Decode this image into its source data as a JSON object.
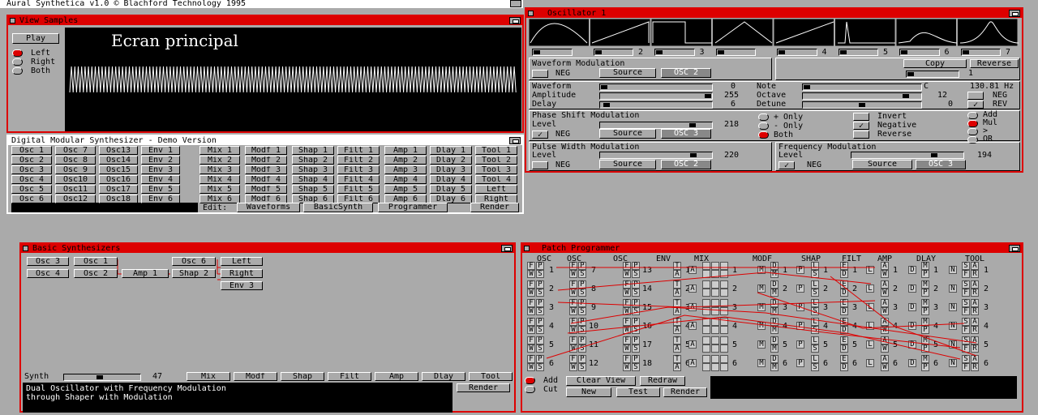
{
  "screen_title": "Aural Synthetica v1.0  © Blachford Technology 1995",
  "view_samples": {
    "title": "View Samples",
    "play": "Play",
    "overlay": "Ecran principal",
    "channels": [
      "Left",
      "Right",
      "Both"
    ],
    "selected": "Left"
  },
  "dms": {
    "title": "Digital Modular Synthesizer - Demo Version",
    "columns": [
      [
        "Osc 1",
        "Osc 2",
        "Osc 3",
        "Osc 4",
        "Osc 5",
        "Osc 6"
      ],
      [
        "Osc 7",
        "Osc 8",
        "Osc 9",
        "Osc10",
        "Osc11",
        "Osc12"
      ],
      [
        "Osc13",
        "Osc14",
        "Osc15",
        "Osc16",
        "Osc17",
        "Osc18"
      ],
      [
        "Env 1",
        "Env 2",
        "Env 3",
        "Env 4",
        "Env 5",
        "Env 6"
      ],
      [
        "Mix 1",
        "Mix 2",
        "Mix 3",
        "Mix 4",
        "Mix 5",
        "Mix 6"
      ],
      [
        "Modf 1",
        "Modf 2",
        "Modf 3",
        "Modf 4",
        "Modf 5",
        "Modf 6"
      ],
      [
        "Shap 1",
        "Shap 2",
        "Shap 3",
        "Shap 4",
        "Shap 5",
        "Shap 6"
      ],
      [
        "Filt 1",
        "Filt 2",
        "Filt 3",
        "Filt 4",
        "Filt 5",
        "Filt 6"
      ],
      [
        "Amp 1",
        "Amp 2",
        "Amp 3",
        "Amp 4",
        "Amp 5",
        "Amp 6"
      ],
      [
        "Dlay 1",
        "Dlay 2",
        "Dlay 3",
        "Dlay 4",
        "Dlay 5",
        "Dlay 6"
      ],
      [
        "Tool 1",
        "Tool 2",
        "Tool 3",
        "Tool 4",
        "Left",
        "Right"
      ]
    ],
    "edit_label": "Edit:",
    "edit_buttons": [
      "Waveforms",
      "BasicSynth",
      "Programmer",
      "Render"
    ]
  },
  "oscillator": {
    "title": "Oscillator 1",
    "wave_numbers": [
      "",
      "2",
      "3",
      "",
      "4",
      "5",
      "6",
      "7"
    ],
    "wave_mod": {
      "title": "Waveform Modulation",
      "neg": "NEG",
      "source": "Source",
      "osc": "OSC 2"
    },
    "copy": "Copy",
    "reverse": "Reverse",
    "copy_num": "1",
    "params": [
      {
        "label": "Waveform",
        "value": "0",
        "level": 0.0
      },
      {
        "label": "Amplitude",
        "value": "255",
        "level": 1.0
      },
      {
        "label": "Delay",
        "value": "6",
        "level": 0.02
      }
    ],
    "note": {
      "label": "Note",
      "letter": "C",
      "value": "130.81 Hz",
      "level": 0.0
    },
    "octave": {
      "label": "Octave",
      "value": "12",
      "level": 0.9,
      "neg": "NEG"
    },
    "detune": {
      "label": "Detune",
      "value": "0",
      "level": 0.5,
      "rev": "REV"
    },
    "phase": {
      "title": "Phase Shift Modulation",
      "level_label": "Level",
      "value": "218",
      "level": 0.85,
      "neg": "NEG",
      "source": "Source",
      "osc": "OSC 3",
      "options": [
        "+ Only",
        "- Only",
        "Both"
      ],
      "selected": "Both",
      "checks": [
        "Invert",
        "Negative",
        "Reverse"
      ],
      "ops": [
        "Add",
        "Mul",
        ">",
        "OR"
      ],
      "op_selected": "Mul"
    },
    "pulse": {
      "title": "Pulse Width Modulation",
      "level_label": "Level",
      "value": "220",
      "level": 0.86,
      "neg": "NEG",
      "source": "Source",
      "osc": "OSC 2"
    },
    "freq": {
      "title": "Frequency Modulation",
      "level_label": "Level",
      "value": "194",
      "level": 0.76,
      "neg": "NEG",
      "source": "Source",
      "osc": "OSC 3"
    }
  },
  "basic": {
    "title": "Basic Synthesizers",
    "modules": [
      "Osc 3",
      "Osc 1",
      "Osc 6",
      "Left",
      "Osc 4",
      "Osc 2",
      "Amp 1",
      "Shap 2",
      "Right",
      "Env 3"
    ],
    "synth_label": "Synth",
    "synth_value": "47",
    "synth_level": 0.47,
    "buttons": [
      "Mix",
      "Modf",
      "Shap",
      "Filt",
      "Amp",
      "Dlay",
      "Tool"
    ],
    "description": [
      "Dual Oscillator with Frequency Modulation",
      "through Shaper with Modulation"
    ],
    "render": "Render"
  },
  "patch": {
    "title": "Patch Programmer",
    "headers": [
      "OSC",
      "OSC",
      "OSC",
      "ENV",
      "MIX",
      "MODF",
      "SHAP",
      "FILT",
      "AMP",
      "DLAY",
      "TOOL"
    ],
    "osc_left": [
      "1",
      "2",
      "3",
      "4",
      "5",
      "6"
    ],
    "osc_mid": [
      "7",
      "8",
      "9",
      "10",
      "11",
      "12"
    ],
    "osc_right": [
      "13",
      "14",
      "15",
      "16",
      "17",
      "18"
    ],
    "cells": {
      "F": "F",
      "P": "P",
      "W": "W",
      "S": "S",
      "T": "T",
      "A": "A",
      "M": "M",
      "D": "D",
      "L": "L",
      "E": "E",
      "N": "N",
      "R": "R"
    },
    "mix_nums": [
      "1",
      "2",
      "3",
      "4",
      "5",
      "6"
    ],
    "modes": [
      "Add",
      "Cut"
    ],
    "mode_selected": "Add",
    "buttons": [
      "Clear View",
      "Redraw",
      "New",
      "Test",
      "Render"
    ],
    "tool_tail": [
      "L",
      "R"
    ]
  }
}
